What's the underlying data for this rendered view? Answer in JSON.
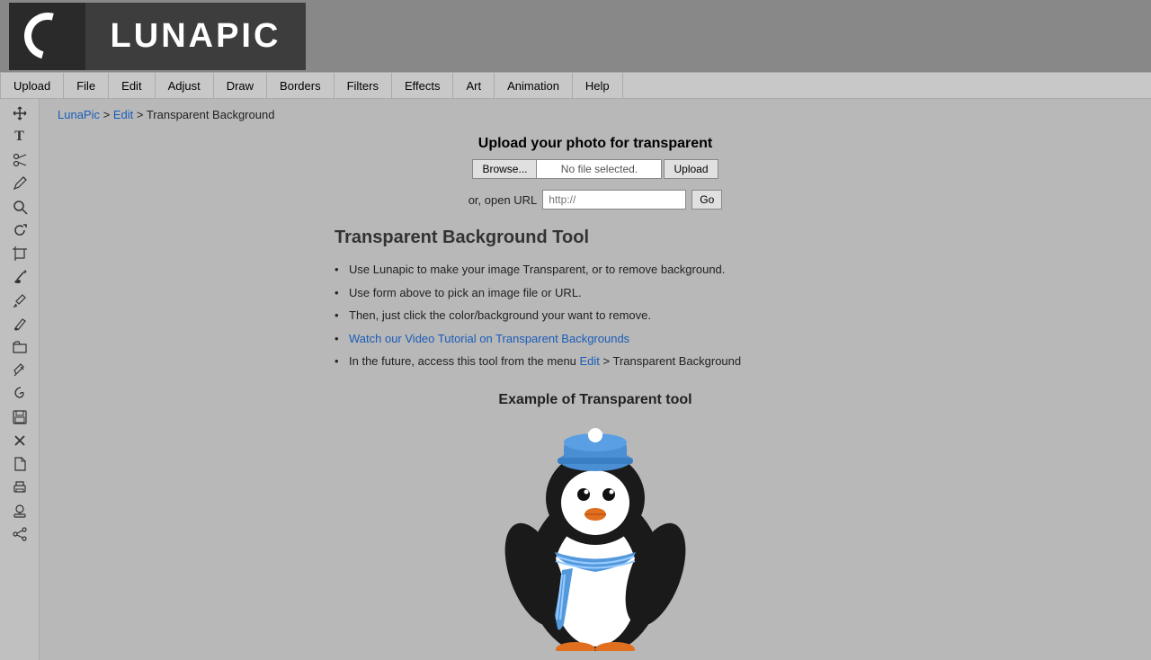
{
  "header": {
    "logo_text": "LUNAPIC",
    "logo_alt": "LunaPic Logo"
  },
  "navbar": {
    "items": [
      "Upload",
      "File",
      "Edit",
      "Adjust",
      "Draw",
      "Borders",
      "Filters",
      "Effects",
      "Art",
      "Animation",
      "Help"
    ]
  },
  "breadcrumb": {
    "home": "LunaPic",
    "separator1": " > ",
    "edit": "Edit",
    "separator2": " > ",
    "current": "Transparent Background"
  },
  "upload": {
    "title": "Upload your photo for transparent",
    "browse_label": "Browse...",
    "file_placeholder": "No file selected.",
    "upload_label": "Upload",
    "url_label": "or, open URL",
    "url_placeholder": "http://",
    "go_label": "Go"
  },
  "tool": {
    "title": "Transparent Background Tool",
    "bullets": [
      "Use Lunapic to make your image Transparent, or to remove background.",
      "Use form above to pick an image file or URL.",
      "Then, just click the color/background your want to remove.",
      "Watch our Video Tutorial on Transparent Backgrounds",
      "In the future, access this tool from the menu Edit > Transparent Background"
    ],
    "bullet4_link_text": "Watch our Video Tutorial on Transparent Backgrounds",
    "bullet5_edit_link": "Edit",
    "bullet5_suffix": " > Transparent Background"
  },
  "example": {
    "title": "Example of Transparent tool"
  },
  "sidebar": {
    "icons": [
      {
        "name": "move-icon",
        "symbol": "⊹"
      },
      {
        "name": "text-icon",
        "symbol": "T"
      },
      {
        "name": "scissors-icon",
        "symbol": "✂"
      },
      {
        "name": "pencil-icon",
        "symbol": "✏"
      },
      {
        "name": "zoom-icon",
        "symbol": "🔍"
      },
      {
        "name": "rotate-icon",
        "symbol": "↻"
      },
      {
        "name": "crop-icon",
        "symbol": "⊡"
      },
      {
        "name": "paint-icon",
        "symbol": "🖌"
      },
      {
        "name": "dropper-icon",
        "symbol": "💧"
      },
      {
        "name": "brush-icon",
        "symbol": "🖊"
      },
      {
        "name": "folder-icon",
        "symbol": "📁"
      },
      {
        "name": "eraser-icon",
        "symbol": "◻"
      },
      {
        "name": "swirl-icon",
        "symbol": "〜"
      },
      {
        "name": "save-icon",
        "symbol": "💾"
      },
      {
        "name": "close-icon",
        "symbol": "✕"
      },
      {
        "name": "file-icon",
        "symbol": "📄"
      },
      {
        "name": "print-icon",
        "symbol": "🖨"
      },
      {
        "name": "copy-icon",
        "symbol": "📋"
      },
      {
        "name": "more-icon",
        "symbol": "⋯"
      }
    ]
  }
}
